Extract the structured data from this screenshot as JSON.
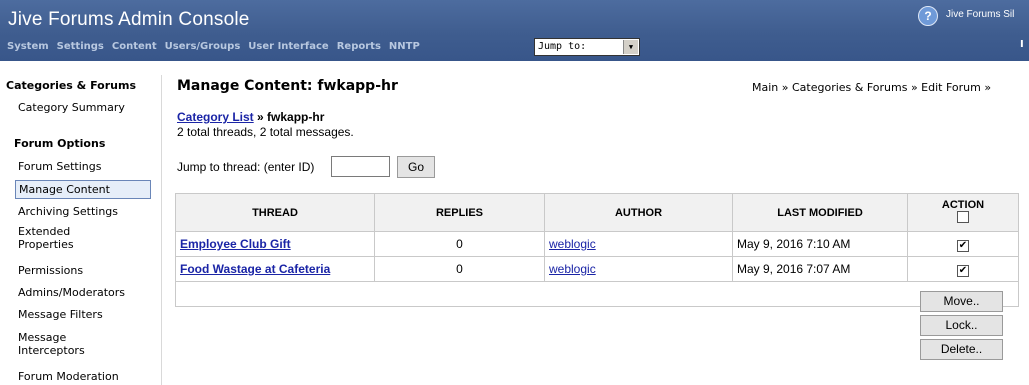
{
  "app": {
    "title": "Jive Forums Admin Console",
    "product": "Jive Forums Sil",
    "corner": "I"
  },
  "nav": {
    "items": [
      "System",
      "Settings",
      "Content",
      "Users/Groups",
      "User Interface",
      "Reports",
      "NNTP"
    ],
    "jump_value": "Jump to:"
  },
  "sidebar": {
    "heading1": "Categories & Forums",
    "summary": "Category Summary",
    "heading2": "Forum Options",
    "items": [
      "Forum Settings",
      "Manage Content",
      "Archiving Settings",
      "Extended Properties",
      "Permissions",
      "Admins/Moderators",
      "Message Filters",
      "Message Interceptors",
      "Forum Moderation"
    ]
  },
  "page": {
    "title": "Manage Content: fwkapp-hr",
    "breadcrumb": "Main » Categories & Forums » Edit Forum »",
    "category_link": "Category List",
    "category_sep": " » ",
    "forum_name": "fwkapp-hr",
    "totals": "2 total threads, 2 total messages.",
    "jump_label": "Jump to thread: (enter ID)",
    "go_label": "Go"
  },
  "table": {
    "headers": [
      "THREAD",
      "REPLIES",
      "AUTHOR",
      "LAST MODIFIED",
      "ACTION"
    ],
    "rows": [
      {
        "thread": "Employee Club Gift",
        "replies": "0",
        "author": "weblogic",
        "modified": "May 9, 2016 7:10 AM",
        "checked": true
      },
      {
        "thread": "Food Wastage at Cafeteria",
        "replies": "0",
        "author": "weblogic",
        "modified": "May 9, 2016 7:07 AM",
        "checked": true
      }
    ]
  },
  "actions": {
    "move": "Move..",
    "lock": "Lock..",
    "delete": "Delete.."
  },
  "colors": {
    "header_bg": "#3f5d8f",
    "link": "#1a24a6"
  }
}
